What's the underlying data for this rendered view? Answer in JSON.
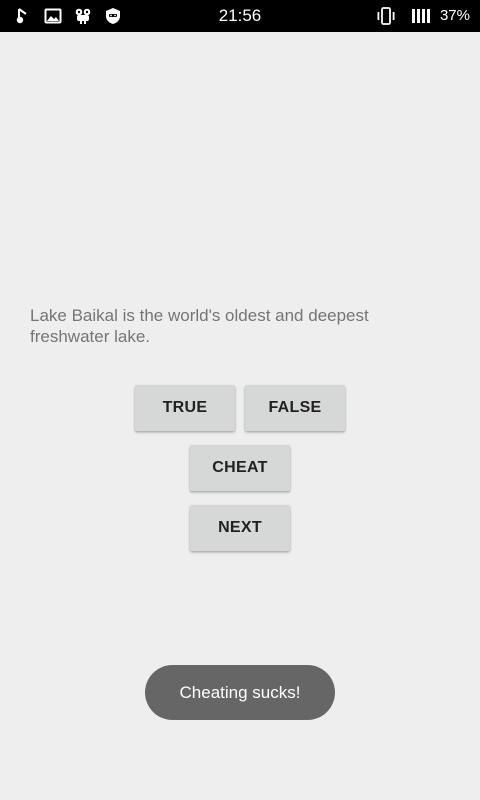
{
  "status_bar": {
    "time": "21:56",
    "battery_percent": "37%",
    "left_icons": [
      "notification-app-icon",
      "image-icon",
      "android-debug-icon",
      "shield-app-icon"
    ],
    "right_icons": [
      "vibrate-icon",
      "signal-icon"
    ]
  },
  "quiz": {
    "question": "Lake Baikal is the world's oldest and deepest freshwater lake.",
    "true_label": "TRUE",
    "false_label": "FALSE",
    "cheat_label": "CHEAT",
    "next_label": "NEXT"
  },
  "toast": {
    "message": "Cheating sucks!"
  },
  "colors": {
    "background": "#eeeeee",
    "status_bar": "#000000",
    "button": "#d6d7d7",
    "question_text": "#757575",
    "toast": "#666666"
  }
}
